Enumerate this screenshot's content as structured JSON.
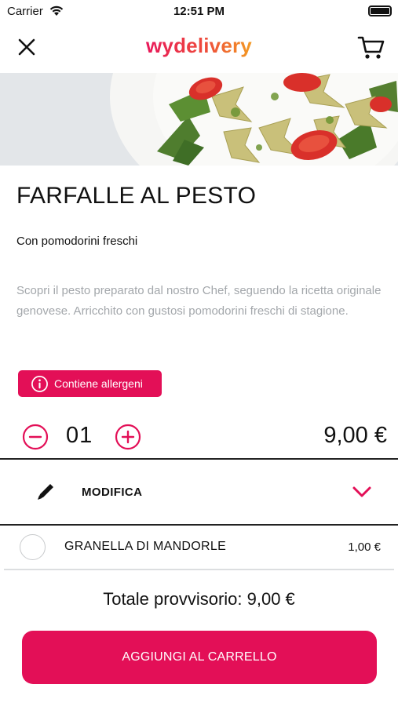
{
  "status_bar": {
    "carrier": "Carrier",
    "time": "12:51 PM"
  },
  "nav": {
    "logo": "wydelivery"
  },
  "product": {
    "title": "FARFALLE AL PESTO",
    "subtitle": "Con pomodorini freschi",
    "description": "Scopri il pesto preparato dal nostro Chef, seguendo la ricetta originale genovese. Arricchito con gustosi pomodorini freschi di stagione."
  },
  "allergens": {
    "label": "Contiene allergeni"
  },
  "quantity": {
    "value": "01",
    "price": "9,00 €"
  },
  "modify": {
    "label": "MODIFICA"
  },
  "extras": [
    {
      "label": "GRANELLA DI MANDORLE",
      "price": "1,00 €",
      "selected": false
    }
  ],
  "total": {
    "label": "Totale provvisorio: 9,00 €"
  },
  "cta": {
    "label": "AGGIUNGI AL CARRELLO"
  },
  "colors": {
    "accent": "#e30f57",
    "text": "#111111",
    "muted": "#a3a7ab"
  }
}
